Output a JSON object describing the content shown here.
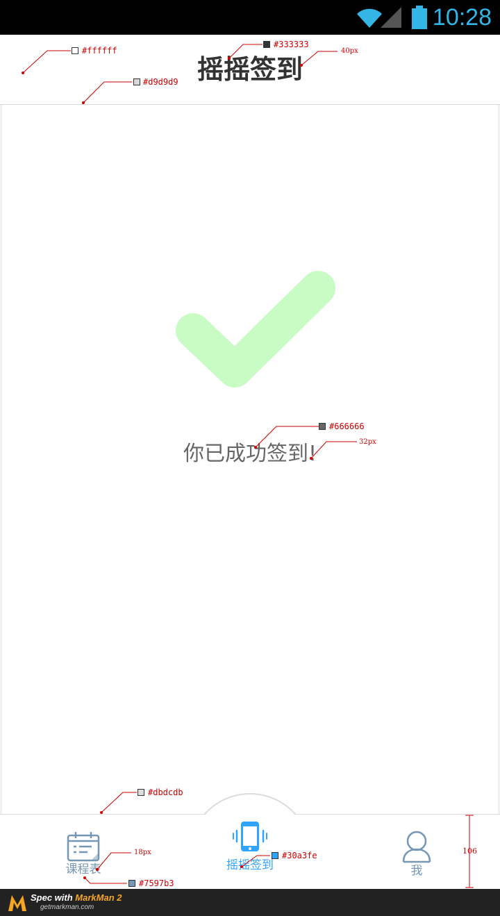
{
  "status_bar": {
    "time": "10:28"
  },
  "header": {
    "title": "摇摇签到"
  },
  "main": {
    "success_text": "你已成功签到!"
  },
  "tabs": [
    {
      "label": "课程表",
      "icon": "calendar-icon",
      "active": false
    },
    {
      "label": "摇摇签到",
      "icon": "phone-shake-icon",
      "active": true
    },
    {
      "label": "我",
      "icon": "user-icon",
      "active": false
    }
  ],
  "annotations": {
    "header_bg": "#ffffff",
    "title_color": "#333333",
    "title_size": "40px",
    "header_border": "#d9d9d9",
    "success_color": "#666666",
    "success_size": "32px",
    "tabbar_border": "#dbdcdb",
    "tab_label_size": "18px",
    "tab_inactive_color": "#7597b3",
    "tab_active_color": "#30a3fe",
    "tabbar_height": "106"
  },
  "footer": {
    "line1_prefix": "Spec with ",
    "line1_brand": "MarkMan 2",
    "line2": "getmarkman.com"
  },
  "colors": {
    "accent": "#30a3fe",
    "muted": "#7597b3",
    "check": "#c8fcc4"
  }
}
